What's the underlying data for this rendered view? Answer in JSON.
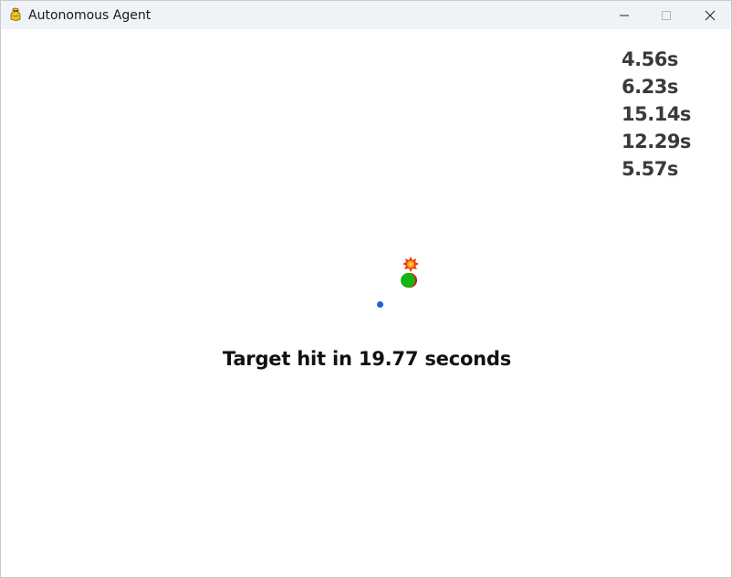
{
  "window": {
    "title": "Autonomous Agent",
    "icon": "pygame-snake-icon",
    "controls": [
      "minimize-icon",
      "maximize-icon",
      "close-icon"
    ]
  },
  "game": {
    "hit_times": [
      "4.56s",
      "6.23s",
      "15.14s",
      "12.29s",
      "5.57s"
    ],
    "status_message": "Target hit in 19.77 seconds",
    "colors": {
      "agent": "#13b513",
      "agent_edge": "#e01010",
      "target_outer": "#e83a10",
      "target_inner": "#ffd020",
      "projectile": "#1e5fe0",
      "background": "#ffffff"
    }
  }
}
